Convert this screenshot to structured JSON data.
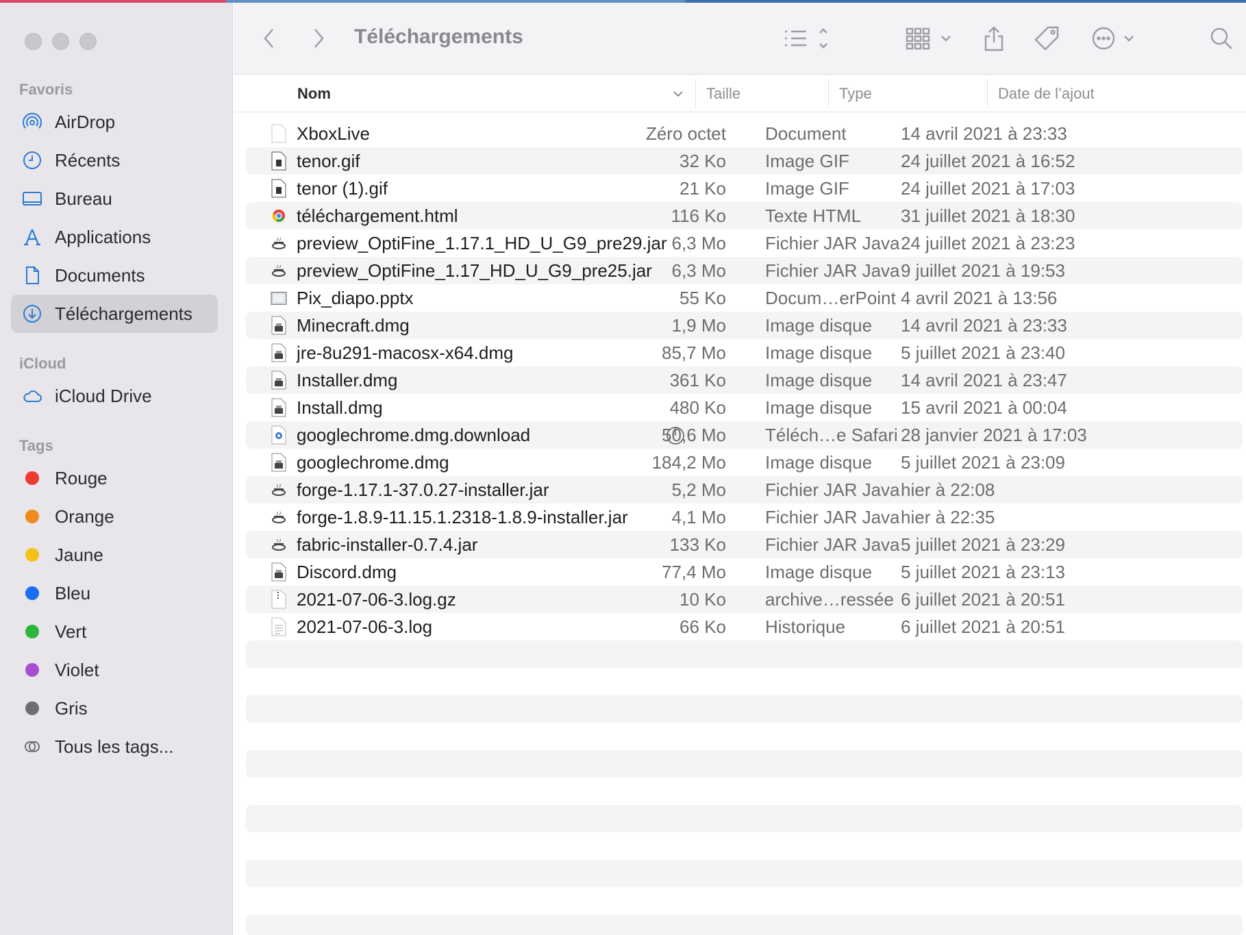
{
  "window": {
    "title": "Téléchargements"
  },
  "sidebar": {
    "favorites_title": "Favoris",
    "favorites": [
      {
        "label": "AirDrop",
        "icon": "airdrop-icon"
      },
      {
        "label": "Récents",
        "icon": "clock-icon"
      },
      {
        "label": "Bureau",
        "icon": "desktop-icon"
      },
      {
        "label": "Applications",
        "icon": "applications-icon"
      },
      {
        "label": "Documents",
        "icon": "document-icon"
      },
      {
        "label": "Téléchargements",
        "icon": "download-icon",
        "selected": true
      }
    ],
    "icloud_title": "iCloud",
    "icloud": [
      {
        "label": "iCloud Drive",
        "icon": "cloud-icon"
      }
    ],
    "tags_title": "Tags",
    "tags": [
      {
        "label": "Rouge",
        "color": "#ee3b32"
      },
      {
        "label": "Orange",
        "color": "#f08a1c"
      },
      {
        "label": "Jaune",
        "color": "#f2c21b"
      },
      {
        "label": "Bleu",
        "color": "#1a6ef2"
      },
      {
        "label": "Vert",
        "color": "#2bb53c"
      },
      {
        "label": "Violet",
        "color": "#a84ed0"
      },
      {
        "label": "Gris",
        "color": "#6e6d72"
      }
    ],
    "all_tags": "Tous les tags..."
  },
  "columns": {
    "name": "Nom",
    "size": "Taille",
    "type": "Type",
    "date": "Date de l’ajout"
  },
  "files": [
    {
      "name": "XboxLive",
      "size": "Zéro octet",
      "type": "Document",
      "date": "14 avril 2021 à 23:33",
      "icon": "blank-file-icon"
    },
    {
      "name": "tenor.gif",
      "size": "32 Ko",
      "type": "Image GIF",
      "date": "24 juillet 2021 à 16:52",
      "icon": "gif-file-icon"
    },
    {
      "name": "tenor (1).gif",
      "size": "21 Ko",
      "type": "Image GIF",
      "date": "24 juillet 2021 à 17:03",
      "icon": "gif-file-icon"
    },
    {
      "name": "téléchargement.html",
      "size": "116 Ko",
      "type": "Texte HTML",
      "date": "31 juillet 2021 à 18:30",
      "icon": "chrome-html-icon"
    },
    {
      "name": "preview_OptiFine_1.17.1_HD_U_G9_pre29.jar",
      "size": "6,3 Mo",
      "type": "Fichier JAR Java",
      "date": "24 juillet 2021 à 23:23",
      "icon": "java-jar-icon"
    },
    {
      "name": "preview_OptiFine_1.17_HD_U_G9_pre25.jar",
      "size": "6,3 Mo",
      "type": "Fichier JAR Java",
      "date": "9 juillet 2021 à 19:53",
      "icon": "java-jar-icon"
    },
    {
      "name": "Pix_diapo.pptx",
      "size": "55 Ko",
      "type": "Docum…erPoint",
      "date": "4 avril 2021 à 13:56",
      "icon": "pptx-file-icon"
    },
    {
      "name": "Minecraft.dmg",
      "size": "1,9 Mo",
      "type": "Image disque",
      "date": "14 avril 2021 à 23:33",
      "icon": "disk-image-icon"
    },
    {
      "name": "jre-8u291-macosx-x64.dmg",
      "size": "85,7 Mo",
      "type": "Image disque",
      "date": "5 juillet 2021 à 23:40",
      "icon": "disk-image-icon"
    },
    {
      "name": "Installer.dmg",
      "size": "361 Ko",
      "type": "Image disque",
      "date": "14 avril 2021 à 23:47",
      "icon": "disk-image-icon"
    },
    {
      "name": "Install.dmg",
      "size": "480 Ko",
      "type": "Image disque",
      "date": "15 avril 2021 à 00:04",
      "icon": "disk-image-icon"
    },
    {
      "name": "googlechrome.dmg.download",
      "size": "50,6 Mo",
      "type": "Téléch…e Safari",
      "date": "28 janvier 2021 à 17:03",
      "icon": "safari-download-icon",
      "progress": true
    },
    {
      "name": "googlechrome.dmg",
      "size": "184,2 Mo",
      "type": "Image disque",
      "date": "5 juillet 2021 à 23:09",
      "icon": "disk-image-icon"
    },
    {
      "name": "forge-1.17.1-37.0.27-installer.jar",
      "size": "5,2 Mo",
      "type": "Fichier JAR Java",
      "date": "hier à 22:08",
      "icon": "java-jar-icon"
    },
    {
      "name": "forge-1.8.9-11.15.1.2318-1.8.9-installer.jar",
      "size": "4,1 Mo",
      "type": "Fichier JAR Java",
      "date": "hier à 22:35",
      "icon": "java-jar-icon"
    },
    {
      "name": "fabric-installer-0.7.4.jar",
      "size": "133 Ko",
      "type": "Fichier JAR Java",
      "date": "5 juillet 2021 à 23:29",
      "icon": "java-jar-icon"
    },
    {
      "name": "Discord.dmg",
      "size": "77,4 Mo",
      "type": "Image disque",
      "date": "5 juillet 2021 à 23:13",
      "icon": "disk-image-icon"
    },
    {
      "name": "2021-07-06-3.log.gz",
      "size": "10 Ko",
      "type": "archive…ressée",
      "date": "6 juillet 2021 à 20:51",
      "icon": "archive-file-icon"
    },
    {
      "name": "2021-07-06-3.log",
      "size": "66 Ko",
      "type": "Historique",
      "date": "6 juillet 2021 à 20:51",
      "icon": "log-file-icon"
    }
  ]
}
